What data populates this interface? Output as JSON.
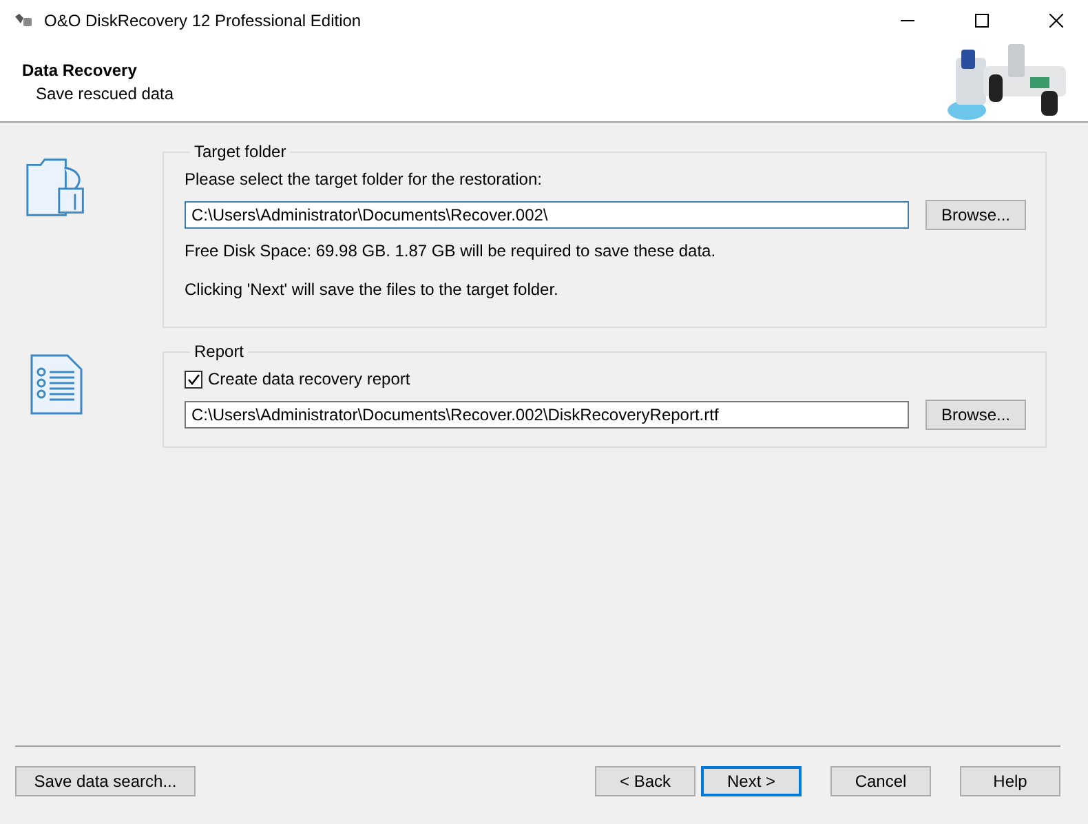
{
  "window": {
    "title": "O&O DiskRecovery 12 Professional Edition"
  },
  "header": {
    "title": "Data Recovery",
    "subtitle": "Save rescued data"
  },
  "target_folder": {
    "legend": "Target folder",
    "prompt": "Please select the target folder for the restoration:",
    "path": {
      "value": "C:\\Users\\Administrator\\Documents\\Recover.002\\",
      "focused": true
    },
    "browse": {
      "label": "Browse..."
    },
    "free_space": "Free Disk Space: 69.98 GB. 1.87 GB will be required to save these data.",
    "note": "Clicking 'Next' will save the files to the target folder."
  },
  "report": {
    "legend": "Report",
    "checkbox": {
      "label": "Create data recovery report",
      "checked": true
    },
    "path": {
      "value": "C:\\Users\\Administrator\\Documents\\Recover.002\\DiskRecoveryReport.rtf",
      "focused": false
    },
    "browse": {
      "label": "Browse..."
    }
  },
  "footer": {
    "left": {
      "label": "Save data search...",
      "default": false
    },
    "buttons": [
      {
        "label": "< Back",
        "default": false
      },
      {
        "label": "Next >",
        "default": true
      },
      {
        "label": "Cancel",
        "default": false
      },
      {
        "label": "Help",
        "default": false
      }
    ]
  }
}
